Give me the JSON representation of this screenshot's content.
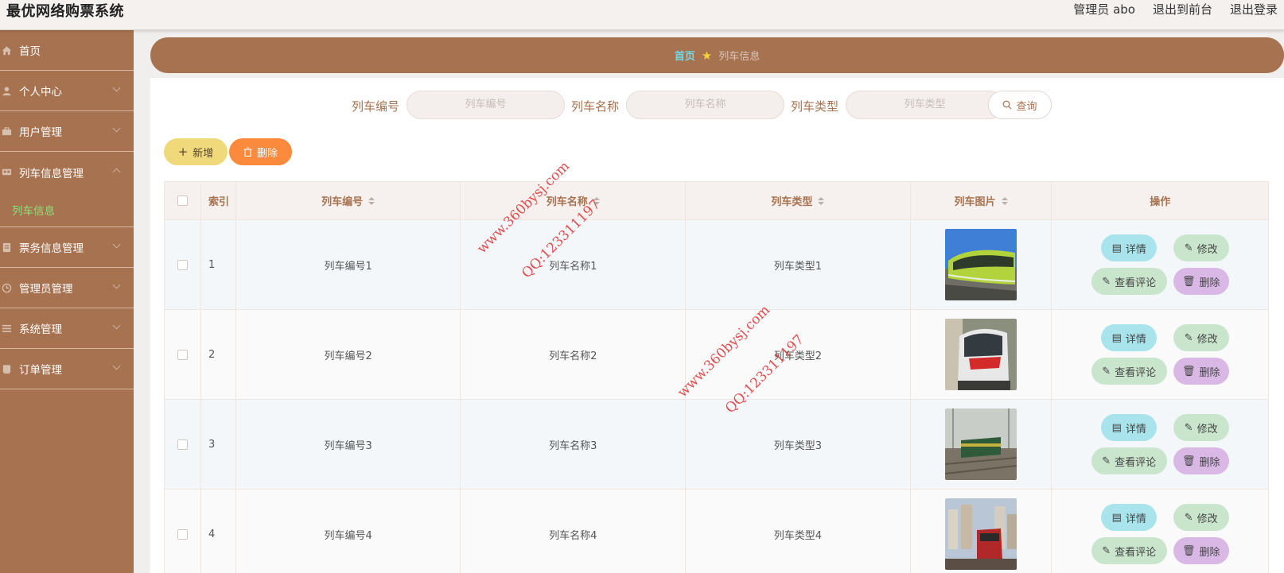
{
  "header": {
    "brand": "最优网络购票系统",
    "user_label": "管理员 abo",
    "to_front": "退出到前台",
    "logout": "退出登录"
  },
  "sidebar": {
    "items": [
      {
        "label": "首页",
        "icon": "home-icon"
      },
      {
        "label": "个人中心",
        "icon": "user-icon"
      },
      {
        "label": "用户管理",
        "icon": "users-icon"
      },
      {
        "label": "列车信息管理",
        "icon": "train-icon",
        "open": true
      },
      {
        "label": "票务信息管理",
        "icon": "ticket-icon"
      },
      {
        "label": "管理员管理",
        "icon": "clock-icon"
      },
      {
        "label": "系统管理",
        "icon": "list-icon"
      },
      {
        "label": "订单管理",
        "icon": "order-icon"
      }
    ],
    "active_sub": "列车信息"
  },
  "breadcrumb": {
    "home": "首页",
    "current": "列车信息"
  },
  "search": {
    "fields": [
      {
        "label": "列车编号",
        "placeholder": "列车编号"
      },
      {
        "label": "列车名称",
        "placeholder": "列车名称"
      },
      {
        "label": "列车类型",
        "placeholder": "列车类型"
      }
    ],
    "button": "查询"
  },
  "actions": {
    "add": "新增",
    "delete": "删除"
  },
  "table": {
    "headers": {
      "index": "索引",
      "number": "列车编号",
      "name": "列车名称",
      "type": "列车类型",
      "image": "列车图片",
      "ops": "操作"
    },
    "rows": [
      {
        "index": "1",
        "number": "列车编号1",
        "name": "列车名称1",
        "type": "列车类型1"
      },
      {
        "index": "2",
        "number": "列车编号2",
        "name": "列车名称2",
        "type": "列车类型2"
      },
      {
        "index": "3",
        "number": "列车编号3",
        "name": "列车名称3",
        "type": "列车类型3"
      },
      {
        "index": "4",
        "number": "列车编号4",
        "name": "列车名称4",
        "type": "列车类型4"
      }
    ],
    "op_labels": {
      "detail": "详情",
      "edit": "修改",
      "review": "查看评论",
      "delete": "删除"
    }
  },
  "watermark": {
    "site": "www.360bysj.com",
    "qq": "QQ:123311197"
  },
  "colors": {
    "primary": "#a7724f",
    "header_bg": "#f4f1ef",
    "breadcrumb_home": "#6fd9ea",
    "sub_active": "#8ce07a",
    "add_btn": "#f0d97a",
    "del_btn": "#fb8a3d",
    "detail_btn": "#a9e4ec",
    "edit_btn": "#c9e6cd",
    "delete_row_btn": "#d9b8e6",
    "watermark": "#e23a3a"
  }
}
